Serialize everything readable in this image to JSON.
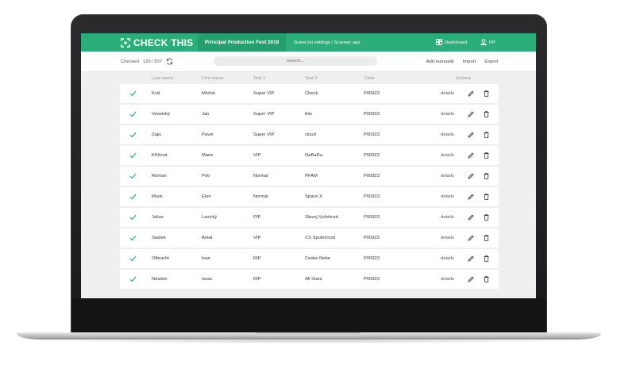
{
  "app": {
    "brand": "CHECK THIS",
    "event_name": "Principal Production Fest 2019",
    "guest_settings": "Guest list settings / Scanner app",
    "dashboard_label": "Dashboard",
    "user_label": "PP",
    "accent_color": "#2cae7b"
  },
  "toolbar": {
    "checked_label": "Checked",
    "checked_count": "120 / 837",
    "search_placeholder": "search...",
    "add_manually": "Add manually",
    "import": "Import",
    "export": "Export"
  },
  "table": {
    "headers": {
      "last_name": "Last name",
      "first_name": "First name",
      "text1": "Text 1",
      "text2": "Text 2",
      "code": "Code",
      "actions": "Actions"
    },
    "details_label": "details",
    "rows": [
      {
        "last": "Král",
        "first": "Michal",
        "text1": "Super VIP",
        "text2": "Check",
        "code": "P00923"
      },
      {
        "last": "Veselský",
        "first": "Jan",
        "text1": "Super VIP",
        "text2": "this",
        "code": "P00923"
      },
      {
        "last": "Zajíc",
        "first": "Pavel",
        "text1": "Super VIP",
        "text2": "cloud",
        "code": "P00923"
      },
      {
        "last": "Křížová",
        "first": "Marie",
        "text1": "VIP",
        "text2": "NaBaRu",
        "code": "P00923"
      },
      {
        "last": "Roman",
        "first": "Petr",
        "text1": "Normal",
        "text2": "PFAM",
        "code": "P00923"
      },
      {
        "last": "Musk",
        "first": "Elon",
        "text1": "Normal",
        "text2": "Space X",
        "code": "P00923"
      },
      {
        "last": "Julius",
        "first": "Lavický",
        "text1": "PIP",
        "text2": "Slavoj Vyšehrad",
        "code": "P00923"
      },
      {
        "last": "Stašek",
        "first": "Antal",
        "text1": "VIP",
        "text2": "CS Společnost",
        "code": "P00923"
      },
      {
        "last": "Olbracht",
        "first": "Ivan",
        "text1": "RIP",
        "text2": "Ceske Nebe",
        "code": "P00923"
      },
      {
        "last": "Newton",
        "first": "Issac",
        "text1": "RIP",
        "text2": "All Stars",
        "code": "P00923"
      }
    ]
  }
}
